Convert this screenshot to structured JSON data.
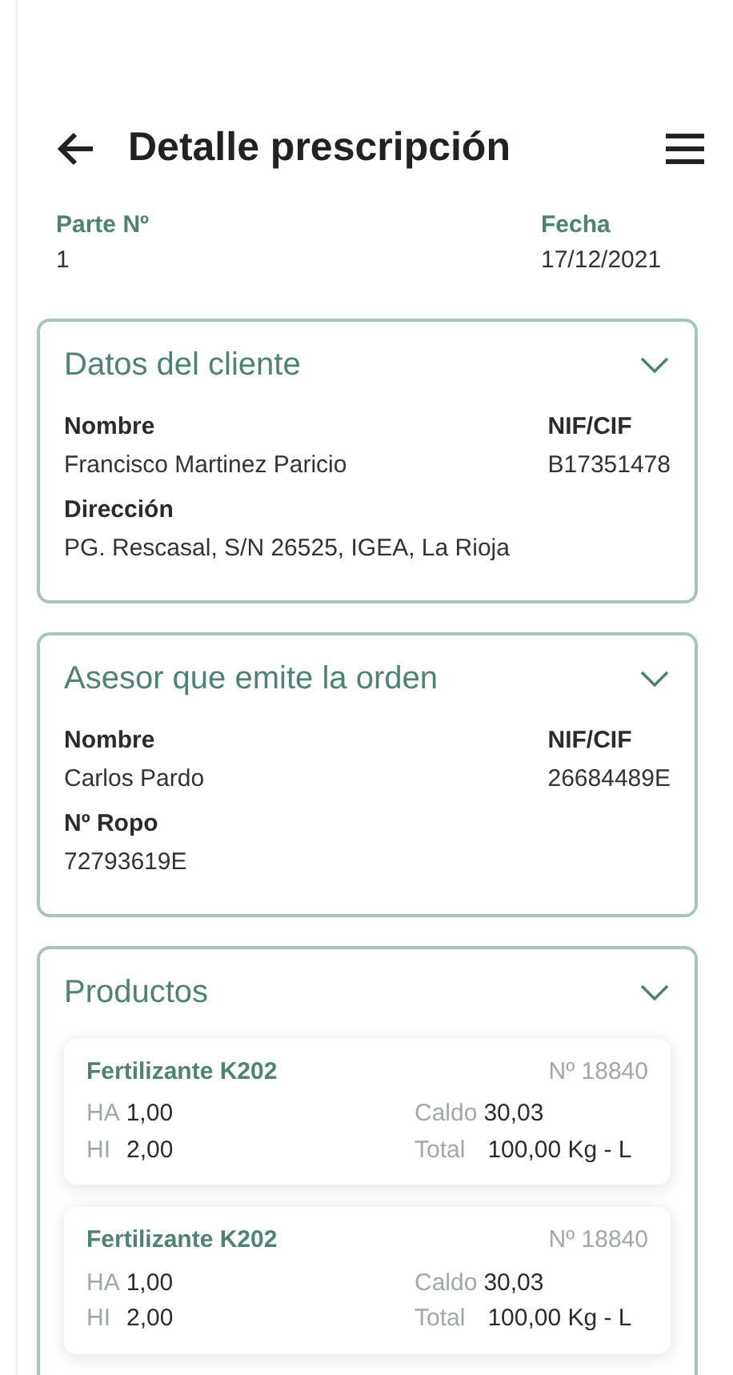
{
  "header": {
    "title": "Detalle prescripción"
  },
  "meta": [
    {
      "label": "Parte Nº",
      "value": "1"
    },
    {
      "label": "Fecha",
      "value": "17/12/2021"
    }
  ],
  "client": {
    "title": "Datos del cliente",
    "fields": [
      {
        "label": "Nombre",
        "value": "Francisco Martinez Paricio"
      },
      {
        "label": "NIF/CIF",
        "value": "B17351478"
      },
      {
        "label": "Dirección",
        "value": "PG. Rescasal, S/N 26525, IGEA, La Rioja"
      }
    ]
  },
  "advisor": {
    "title": "Asesor que emite la orden",
    "fields": [
      {
        "label": "Nombre",
        "value": "Carlos Pardo"
      },
      {
        "label": "NIF/CIF",
        "value": "26684489E"
      },
      {
        "label": "Nº Ropo",
        "value": "72793619E"
      }
    ]
  },
  "products": {
    "title": "Productos",
    "items": [
      {
        "name": "Fertilizante K202",
        "number": "Nº 18840",
        "ha_label": "HA",
        "ha": "1,00",
        "hi_label": "HI",
        "hi": "2,00",
        "caldo_label": "Caldo",
        "caldo": "30,03",
        "total_label": "Total",
        "total": "100,00 Kg - L"
      },
      {
        "name": "Fertilizante K202",
        "number": "Nº 18840",
        "ha_label": "HA",
        "ha": "1,00",
        "hi_label": "HI",
        "hi": "2,00",
        "caldo_label": "Caldo",
        "caldo": "30,03",
        "total_label": "Total",
        "total": "100,00 Kg - L"
      }
    ]
  }
}
